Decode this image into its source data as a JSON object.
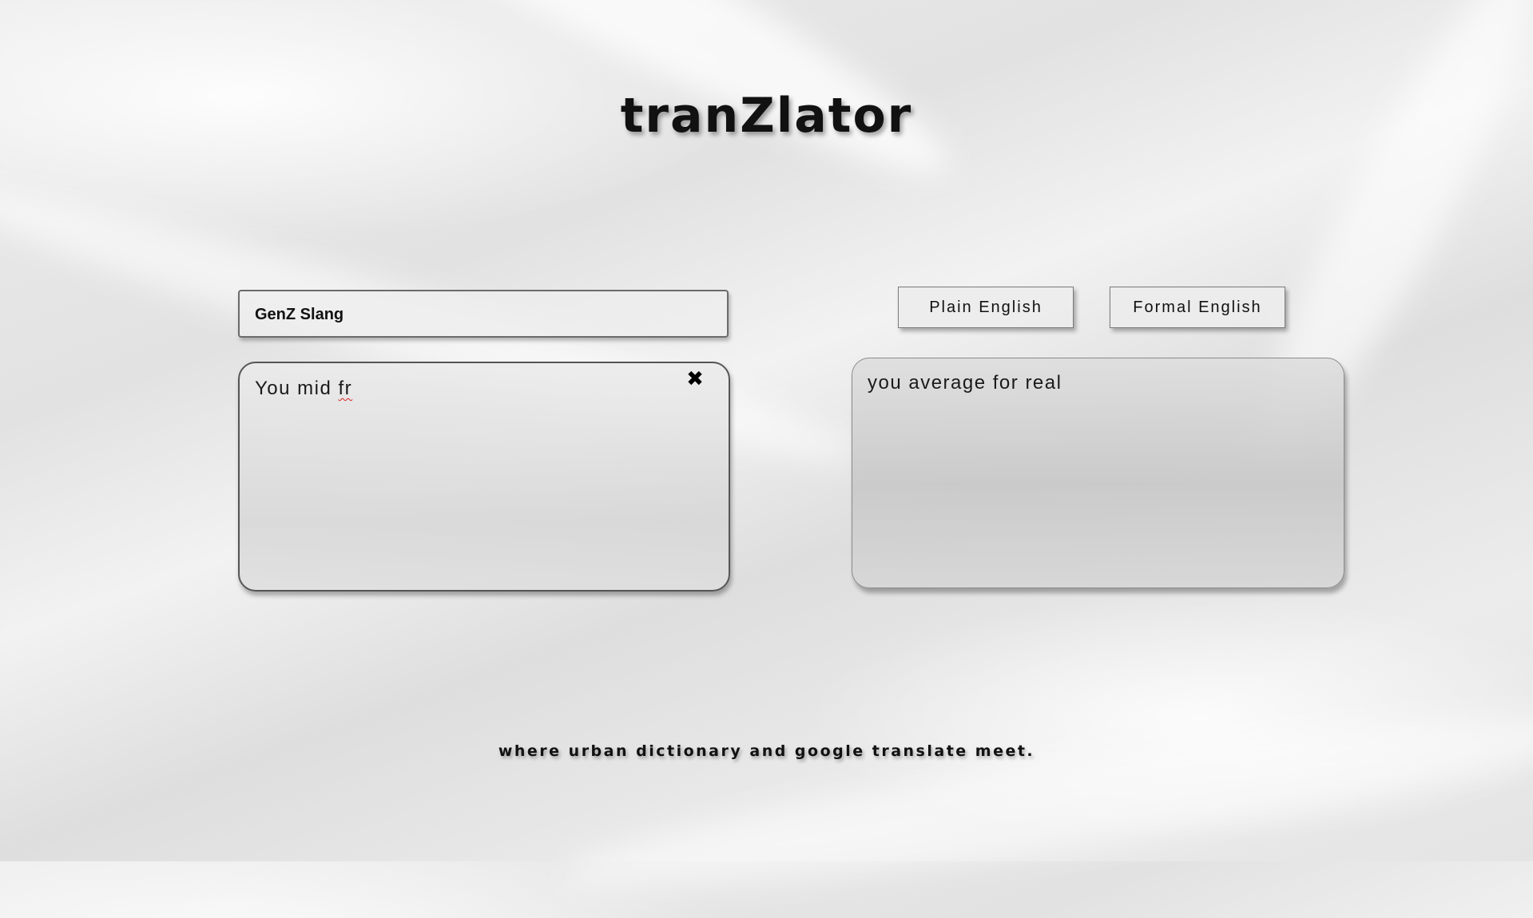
{
  "app": {
    "title": "tranZlator",
    "tagline": "where urban dictionary and google translate meet."
  },
  "source": {
    "language_label": "GenZ Slang",
    "input_text_main": "You mid ",
    "input_text_flagged": "fr",
    "clear_icon": "✖"
  },
  "target": {
    "modes": [
      {
        "label": "Plain English"
      },
      {
        "label": "Formal English"
      }
    ],
    "output_text": "you average for real"
  },
  "icons": {
    "clear": "close-x-icon"
  }
}
